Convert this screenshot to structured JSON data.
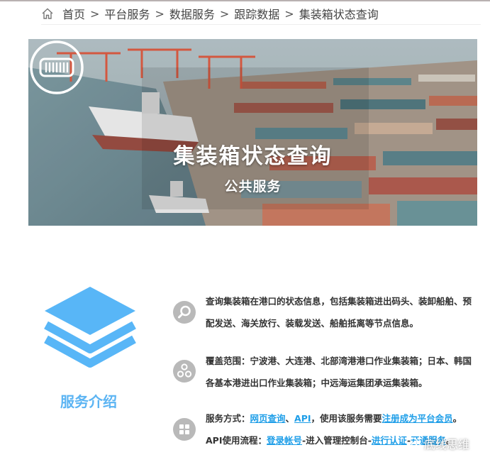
{
  "breadcrumb": {
    "items": [
      "首页",
      "平台服务",
      "数据服务",
      "跟踪数据"
    ],
    "separator": ">",
    "current": "集装箱状态查询"
  },
  "banner": {
    "title": "集装箱状态查询",
    "subtitle": "公共服务"
  },
  "service": {
    "title": "服务介绍",
    "icon": "layers-icon",
    "accent_color": "#5bb4f3"
  },
  "info": {
    "p1": "查询集装箱在港口的状态信息，包括集装箱进出码头、装卸船舶、预配发送、海关放行、装载发送、船舶抵离等节点信息。",
    "p2": "覆盖范围：宁波港、大连港、北部湾港港口作业集装箱；日本、韩国各基本港进出口作业集装箱；中远海运集团承运集装箱。",
    "p3": {
      "label1": "服务方式：",
      "link1": "网页查询",
      "sep1": "、",
      "link2": "API",
      "text1": "，使用该服务需要",
      "link3": "注册成为平台会员",
      "end1": "。",
      "label2": "API使用流程：",
      "link4": "登录帐号",
      "text2": "-进入管理控制台-",
      "link5": "进行认证",
      "text3": "-",
      "link6": "开通服务",
      "end2": "。"
    },
    "link_color": "#1e9ee8"
  },
  "watermark": {
    "text": "底线思维",
    "icon": "wechat-icon"
  }
}
